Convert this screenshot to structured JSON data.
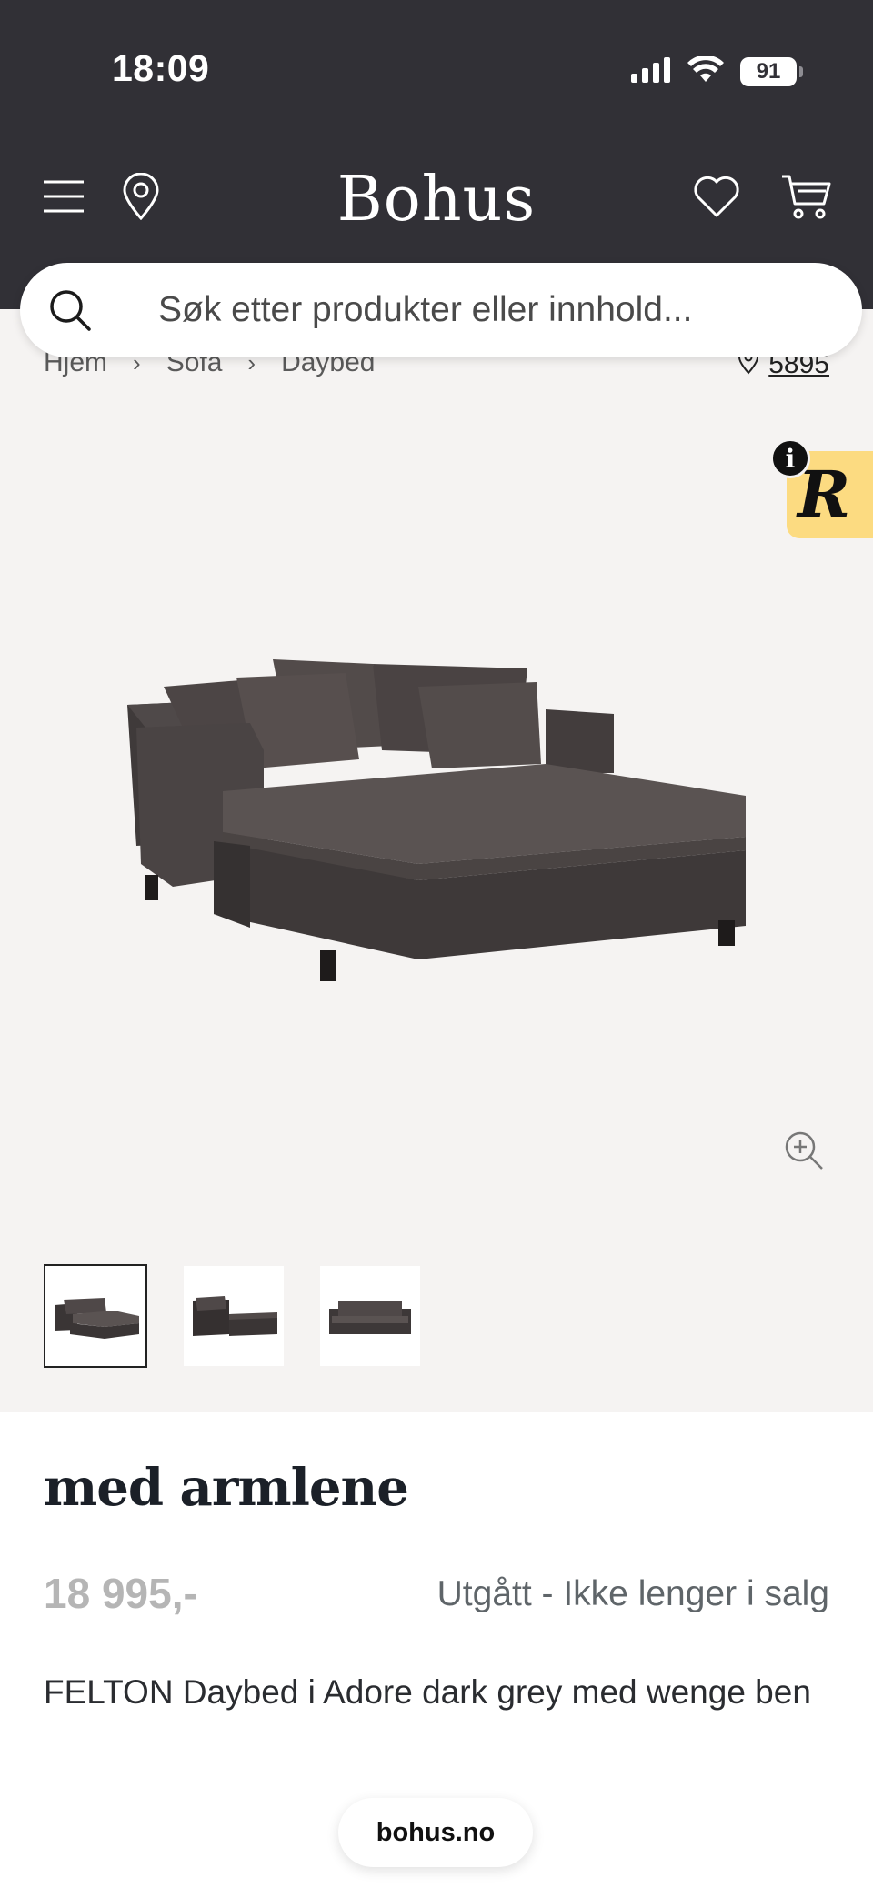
{
  "status_bar": {
    "time": "18:09",
    "battery": "91"
  },
  "header": {
    "logo": "Bohus"
  },
  "search": {
    "placeholder": "Søk etter produkter eller innhold..."
  },
  "breadcrumb": {
    "items": [
      "Hjem",
      "Sofa",
      "Daybed"
    ]
  },
  "store": {
    "number": "5895"
  },
  "review_badge": {
    "letter": "R",
    "info": "i"
  },
  "gallery": {
    "thumbnail_count": 3,
    "active_thumbnail": 1
  },
  "product": {
    "title": "med armlene",
    "price": "18 995,-",
    "availability": "Utgått - Ikke lenger i salg",
    "description": "FELTON Daybed i Adore dark grey med wenge ben"
  },
  "browser": {
    "url": "bohus.no"
  },
  "colors": {
    "header_bg": "#313036",
    "gallery_bg": "#f5f3f2",
    "badge_yellow": "#fcdb81",
    "sofa": "#4a4443"
  }
}
